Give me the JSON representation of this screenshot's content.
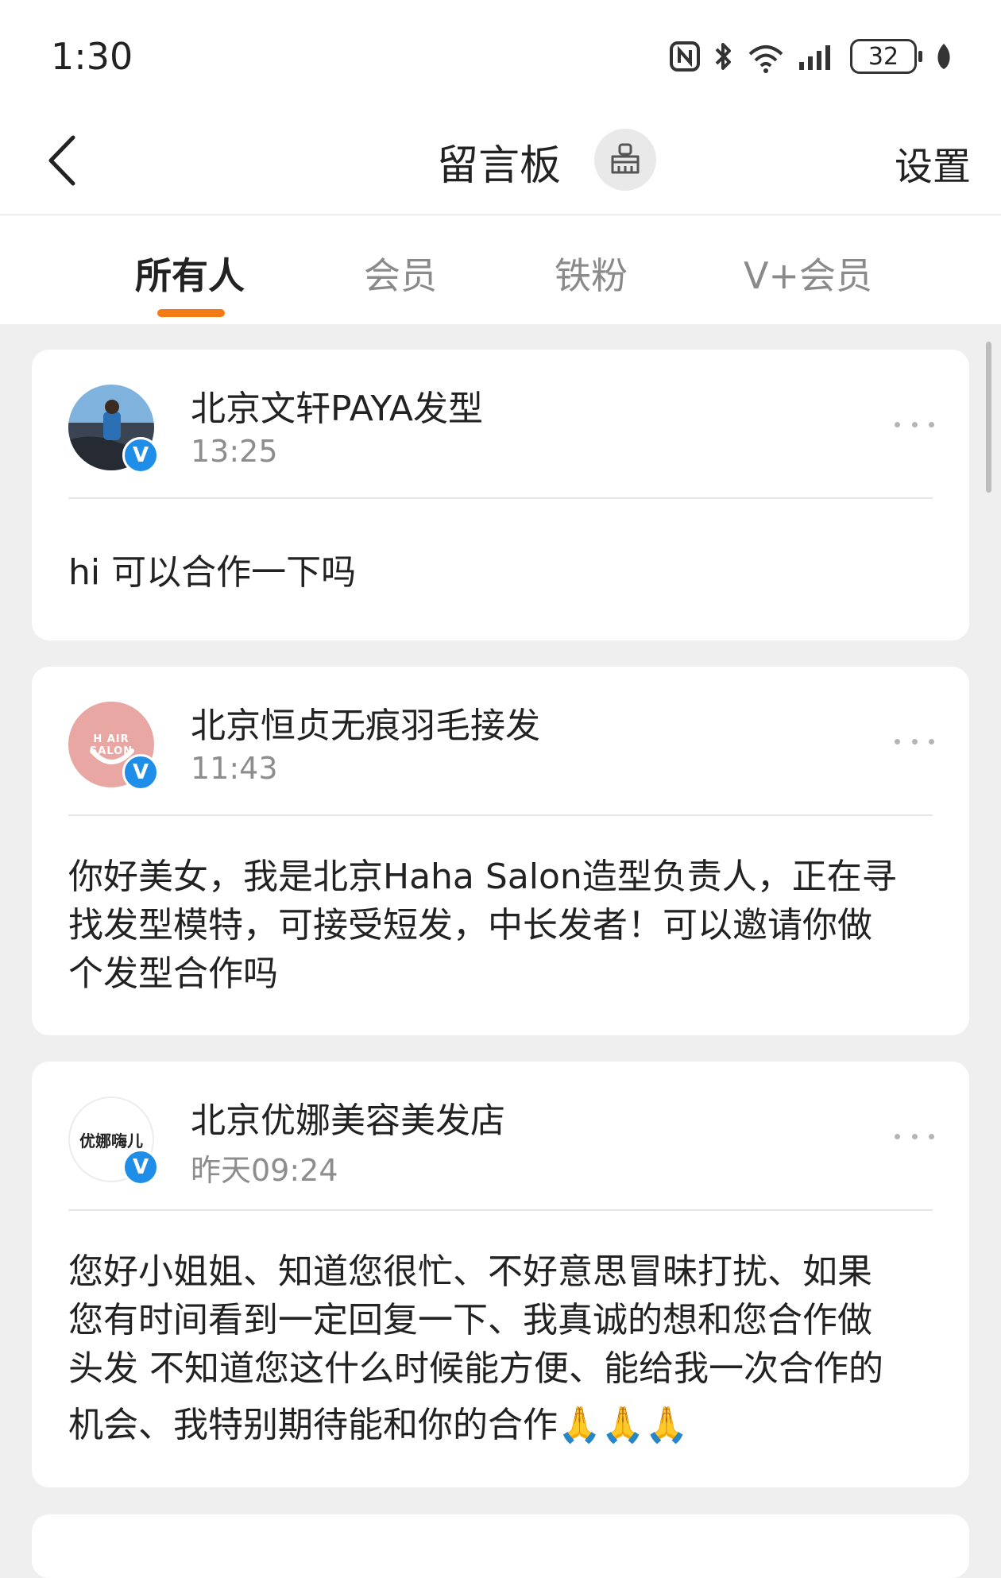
{
  "status_bar": {
    "time": "1:30",
    "battery": "32",
    "icons": [
      "nfc-icon",
      "bluetooth-icon",
      "wifi-6-icon",
      "signal-icon",
      "battery-icon",
      "leaf-icon"
    ]
  },
  "header": {
    "title": "留言板",
    "settings_label": "设置",
    "icons": {
      "back": "chevron-left-icon",
      "clean": "broom-icon"
    }
  },
  "tabs": [
    {
      "label": "所有人",
      "active": true
    },
    {
      "label": "会员",
      "active": false
    },
    {
      "label": "铁粉",
      "active": false
    },
    {
      "label": "V+会员",
      "active": false
    }
  ],
  "messages": [
    {
      "author": "北京文轩PAYA发型",
      "time": "13:25",
      "verified": true,
      "lines": [
        "hi  可以合作一下吗"
      ]
    },
    {
      "author": "北京恒贞无痕羽毛接发",
      "time": "11:43",
      "verified": true,
      "avatar_text": "H AIR SALON",
      "lines": [
        "你好美女，我是北京Haha Salon造型负责人，正在寻",
        "找发型模特，可接受短发，中长发者！可以邀请你做",
        "个发型合作吗"
      ]
    },
    {
      "author": "北京优娜美容美发店",
      "time": "昨天09:24",
      "verified": true,
      "avatar_text": "优娜嗨儿",
      "lines": [
        "您好小姐姐、知道您很忙、不好意思冒昧打扰、如果",
        "您有时间看到一定回复一下、我真诚的想和您合作做",
        "头发 不知道您这什么时候能方便、能给我一次合作的",
        "机会、我特别期待能和你的合作🙏🙏🙏"
      ]
    }
  ],
  "colors": {
    "accent": "#f47b13",
    "verified": "#1e8ee8",
    "background": "#efefef"
  },
  "verified_mark": "V"
}
